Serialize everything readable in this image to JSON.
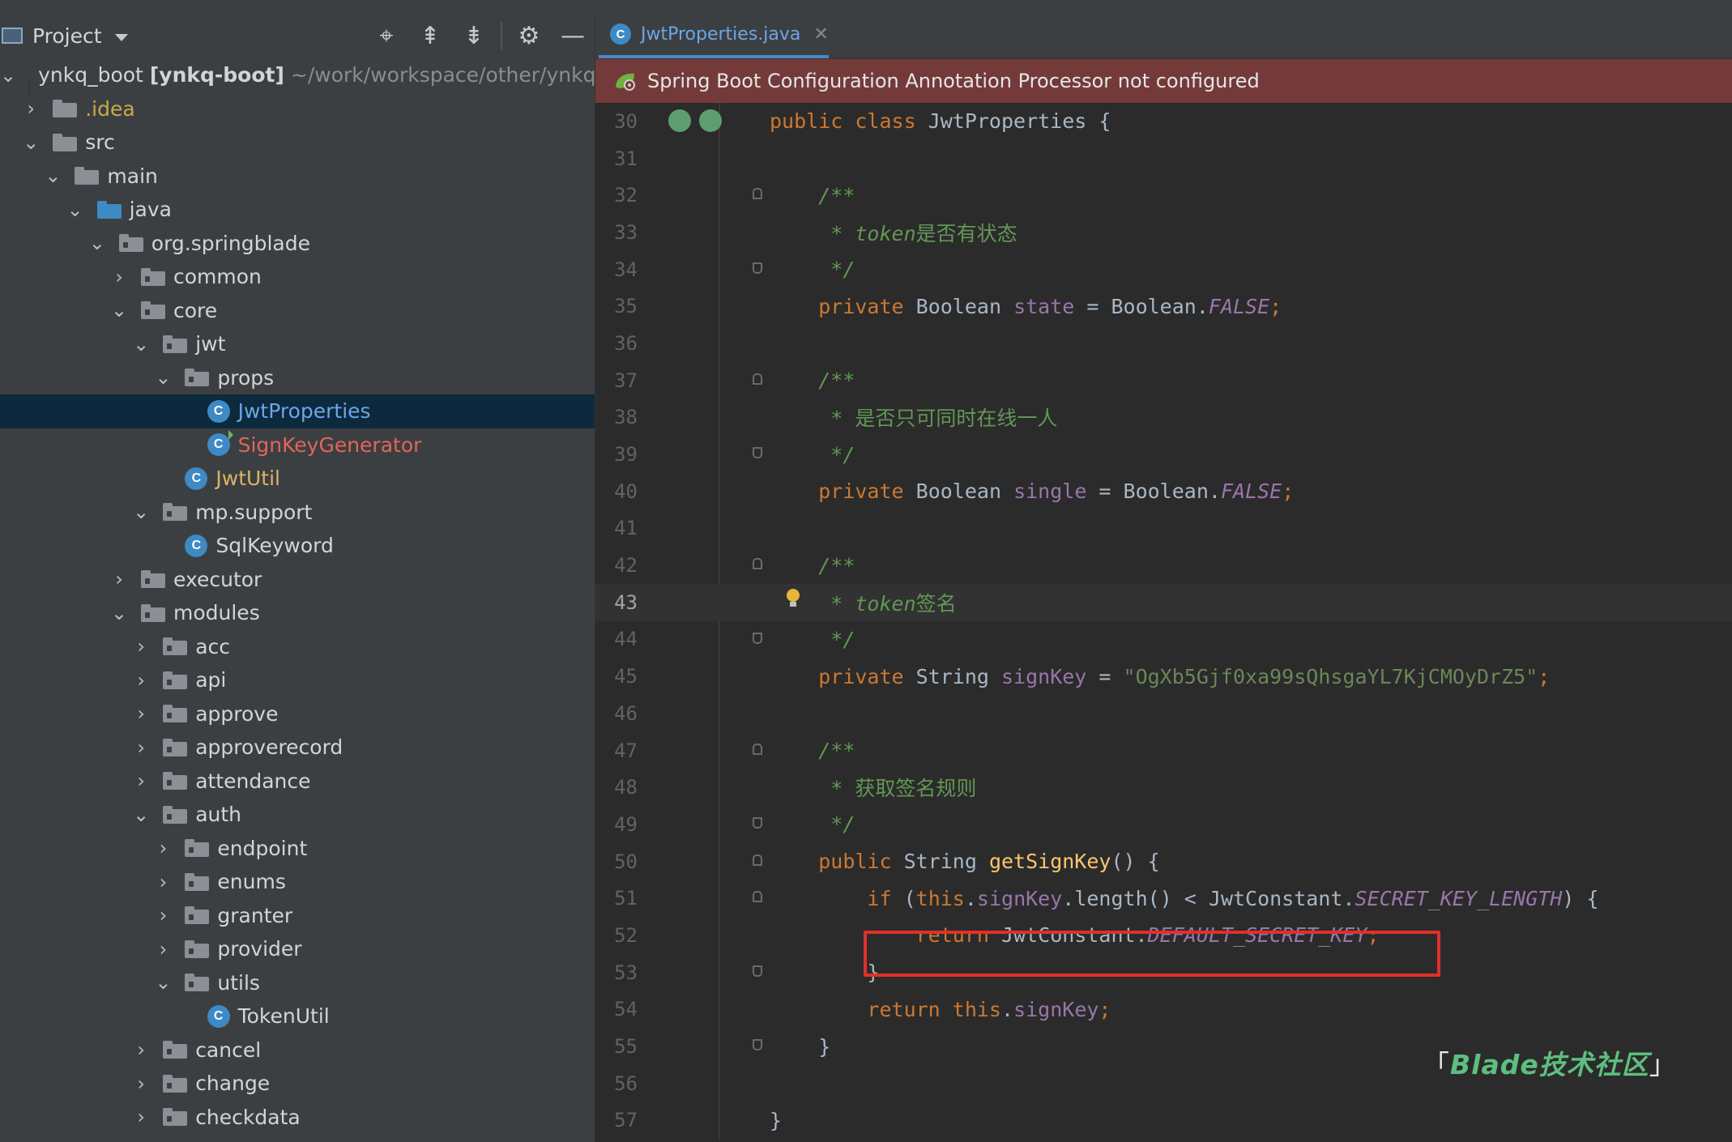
{
  "project_panel": {
    "title": "Project",
    "tools": [
      {
        "name": "locate-icon",
        "glyph": "⌖"
      },
      {
        "name": "expand-all-icon",
        "glyph": "⇞"
      },
      {
        "name": "collapse-all-icon",
        "glyph": "⇟"
      },
      {
        "name": "gear-icon",
        "glyph": "⚙"
      },
      {
        "name": "hide-icon",
        "glyph": "—"
      }
    ],
    "root": {
      "name": "ynkq_boot",
      "module": "[ynkq-boot]",
      "path": "~/work/workspace/other/ynkq/yn"
    },
    "tree": [
      {
        "depth": 1,
        "arrow": "›",
        "icon": "folder",
        "label": ".idea",
        "style": "yellow"
      },
      {
        "depth": 1,
        "arrow": "⌄",
        "icon": "folder",
        "label": "src"
      },
      {
        "depth": 2,
        "arrow": "⌄",
        "icon": "folder",
        "label": "main"
      },
      {
        "depth": 3,
        "arrow": "⌄",
        "icon": "folder-blue",
        "label": "java"
      },
      {
        "depth": 4,
        "arrow": "⌄",
        "icon": "package",
        "label": "org.springblade"
      },
      {
        "depth": 5,
        "arrow": "›",
        "icon": "package",
        "label": "common"
      },
      {
        "depth": 5,
        "arrow": "⌄",
        "icon": "package",
        "label": "core"
      },
      {
        "depth": 6,
        "arrow": "⌄",
        "icon": "package",
        "label": "jwt"
      },
      {
        "depth": 7,
        "arrow": "⌄",
        "icon": "package",
        "label": "props"
      },
      {
        "depth": 8,
        "arrow": "",
        "icon": "class",
        "label": "JwtProperties",
        "style": "blue",
        "selected": true
      },
      {
        "depth": 8,
        "arrow": "",
        "icon": "class-gen",
        "label": "SignKeyGenerator",
        "style": "red"
      },
      {
        "depth": 7,
        "arrow": "",
        "icon": "class",
        "label": "JwtUtil",
        "style": "gold"
      },
      {
        "depth": 6,
        "arrow": "⌄",
        "icon": "package",
        "label": "mp.support"
      },
      {
        "depth": 7,
        "arrow": "",
        "icon": "class",
        "label": "SqlKeyword"
      },
      {
        "depth": 5,
        "arrow": "›",
        "icon": "package",
        "label": "executor"
      },
      {
        "depth": 5,
        "arrow": "⌄",
        "icon": "package",
        "label": "modules"
      },
      {
        "depth": 6,
        "arrow": "›",
        "icon": "package",
        "label": "acc"
      },
      {
        "depth": 6,
        "arrow": "›",
        "icon": "package",
        "label": "api"
      },
      {
        "depth": 6,
        "arrow": "›",
        "icon": "package",
        "label": "approve"
      },
      {
        "depth": 6,
        "arrow": "›",
        "icon": "package",
        "label": "approverecord"
      },
      {
        "depth": 6,
        "arrow": "›",
        "icon": "package",
        "label": "attendance"
      },
      {
        "depth": 6,
        "arrow": "⌄",
        "icon": "package",
        "label": "auth"
      },
      {
        "depth": 7,
        "arrow": "›",
        "icon": "package",
        "label": "endpoint"
      },
      {
        "depth": 7,
        "arrow": "›",
        "icon": "package",
        "label": "enums"
      },
      {
        "depth": 7,
        "arrow": "›",
        "icon": "package",
        "label": "granter"
      },
      {
        "depth": 7,
        "arrow": "›",
        "icon": "package",
        "label": "provider"
      },
      {
        "depth": 7,
        "arrow": "⌄",
        "icon": "package",
        "label": "utils"
      },
      {
        "depth": 8,
        "arrow": "",
        "icon": "class",
        "label": "TokenUtil"
      },
      {
        "depth": 6,
        "arrow": "›",
        "icon": "package",
        "label": "cancel"
      },
      {
        "depth": 6,
        "arrow": "›",
        "icon": "package",
        "label": "change"
      },
      {
        "depth": 6,
        "arrow": "›",
        "icon": "package",
        "label": "checkdata"
      }
    ]
  },
  "editor": {
    "tab": {
      "label": "JwtProperties.java",
      "close": "✕"
    },
    "banner": "Spring Boot Configuration Annotation Processor not configured",
    "current_line": 43,
    "lines": [
      {
        "n": "30",
        "marks": "run",
        "parts": [
          [
            "kw",
            "public class "
          ],
          [
            "tx",
            "JwtProperties {"
          ]
        ]
      },
      {
        "n": "31",
        "parts": []
      },
      {
        "n": "32",
        "fold": "up",
        "parts": [
          [
            "tx",
            "    "
          ],
          [
            "cm",
            "/**"
          ]
        ]
      },
      {
        "n": "33",
        "parts": [
          [
            "tx",
            "     "
          ],
          [
            "cm",
            "* token"
          ],
          [
            "cmzh",
            "是否有状态"
          ]
        ]
      },
      {
        "n": "34",
        "fold": "down",
        "parts": [
          [
            "tx",
            "     "
          ],
          [
            "cm",
            "*/"
          ]
        ]
      },
      {
        "n": "35",
        "parts": [
          [
            "tx",
            "    "
          ],
          [
            "kw",
            "private "
          ],
          [
            "tx",
            "Boolean "
          ],
          [
            "fd",
            "state"
          ],
          [
            "tx",
            " = Boolean."
          ],
          [
            "cst",
            "FALSE"
          ],
          [
            "kw",
            ";"
          ]
        ]
      },
      {
        "n": "36",
        "parts": []
      },
      {
        "n": "37",
        "fold": "up",
        "parts": [
          [
            "tx",
            "    "
          ],
          [
            "cm",
            "/**"
          ]
        ]
      },
      {
        "n": "38",
        "parts": [
          [
            "tx",
            "     "
          ],
          [
            "cm",
            "* "
          ],
          [
            "cmzh",
            "是否只可同时在线一人"
          ]
        ]
      },
      {
        "n": "39",
        "fold": "down",
        "parts": [
          [
            "tx",
            "     "
          ],
          [
            "cm",
            "*/"
          ]
        ]
      },
      {
        "n": "40",
        "parts": [
          [
            "tx",
            "    "
          ],
          [
            "kw",
            "private "
          ],
          [
            "tx",
            "Boolean "
          ],
          [
            "fd",
            "single"
          ],
          [
            "tx",
            " = Boolean."
          ],
          [
            "cst",
            "FALSE"
          ],
          [
            "kw",
            ";"
          ]
        ]
      },
      {
        "n": "41",
        "parts": []
      },
      {
        "n": "42",
        "fold": "up",
        "parts": [
          [
            "tx",
            "    "
          ],
          [
            "cm",
            "/**"
          ]
        ]
      },
      {
        "n": "43",
        "bulb": true,
        "parts": [
          [
            "tx",
            "     "
          ],
          [
            "cm",
            "* token"
          ],
          [
            "cmzh",
            "签名"
          ]
        ]
      },
      {
        "n": "44",
        "fold": "down",
        "parts": [
          [
            "tx",
            "     "
          ],
          [
            "cm",
            "*/"
          ]
        ]
      },
      {
        "n": "45",
        "parts": [
          [
            "tx",
            "    "
          ],
          [
            "kw",
            "private "
          ],
          [
            "tx",
            "String "
          ],
          [
            "fd",
            "signKey"
          ],
          [
            "tx",
            " = "
          ],
          [
            "st",
            "\"OgXb5Gjf0xa99sQhsgaYL7KjCMOyDrZ5\""
          ],
          [
            "kw",
            ";"
          ]
        ]
      },
      {
        "n": "46",
        "parts": []
      },
      {
        "n": "47",
        "fold": "up",
        "parts": [
          [
            "tx",
            "    "
          ],
          [
            "cm",
            "/**"
          ]
        ]
      },
      {
        "n": "48",
        "parts": [
          [
            "tx",
            "     "
          ],
          [
            "cm",
            "* "
          ],
          [
            "cmzh",
            "获取签名规则"
          ]
        ]
      },
      {
        "n": "49",
        "fold": "down",
        "parts": [
          [
            "tx",
            "     "
          ],
          [
            "cm",
            "*/"
          ]
        ]
      },
      {
        "n": "50",
        "fold": "up",
        "parts": [
          [
            "tx",
            "    "
          ],
          [
            "kw",
            "public "
          ],
          [
            "tx",
            "String "
          ],
          [
            "mt",
            "getSignKey"
          ],
          [
            "tx",
            "() {"
          ]
        ]
      },
      {
        "n": "51",
        "fold": "up",
        "parts": [
          [
            "tx",
            "        "
          ],
          [
            "kw",
            "if "
          ],
          [
            "tx",
            "("
          ],
          [
            "kw",
            "this"
          ],
          [
            "tx",
            "."
          ],
          [
            "fd",
            "signKey"
          ],
          [
            "tx",
            ".length() < JwtConstant."
          ],
          [
            "cst",
            "SECRET_KEY_LENGTH"
          ],
          [
            "tx",
            ") {"
          ]
        ]
      },
      {
        "n": "52",
        "parts": [
          [
            "tx",
            "            "
          ],
          [
            "kw",
            "return "
          ],
          [
            "tx",
            "JwtConstant."
          ],
          [
            "cst",
            "DEFAULT_SECRET_KEY"
          ],
          [
            "kw",
            ";"
          ]
        ]
      },
      {
        "n": "53",
        "fold": "down",
        "parts": [
          [
            "tx",
            "        }"
          ]
        ]
      },
      {
        "n": "54",
        "parts": [
          [
            "tx",
            "        "
          ],
          [
            "kw",
            "return this"
          ],
          [
            "tx",
            "."
          ],
          [
            "fd",
            "signKey"
          ],
          [
            "kw",
            ";"
          ]
        ]
      },
      {
        "n": "55",
        "fold": "down",
        "parts": [
          [
            "tx",
            "    }"
          ]
        ]
      },
      {
        "n": "56",
        "parts": []
      },
      {
        "n": "57",
        "parts": [
          [
            "tx",
            "}"
          ]
        ]
      }
    ]
  },
  "watermark": {
    "open": "「",
    "text": "Blade技术社区",
    "close": "」"
  },
  "colors": {
    "keyword": "#cc7832",
    "comment": "#629755",
    "field": "#9876aa",
    "string": "#6a8759",
    "method": "#ffc66d",
    "banner": "#743a3a",
    "highlight_box": "#e0302a"
  }
}
